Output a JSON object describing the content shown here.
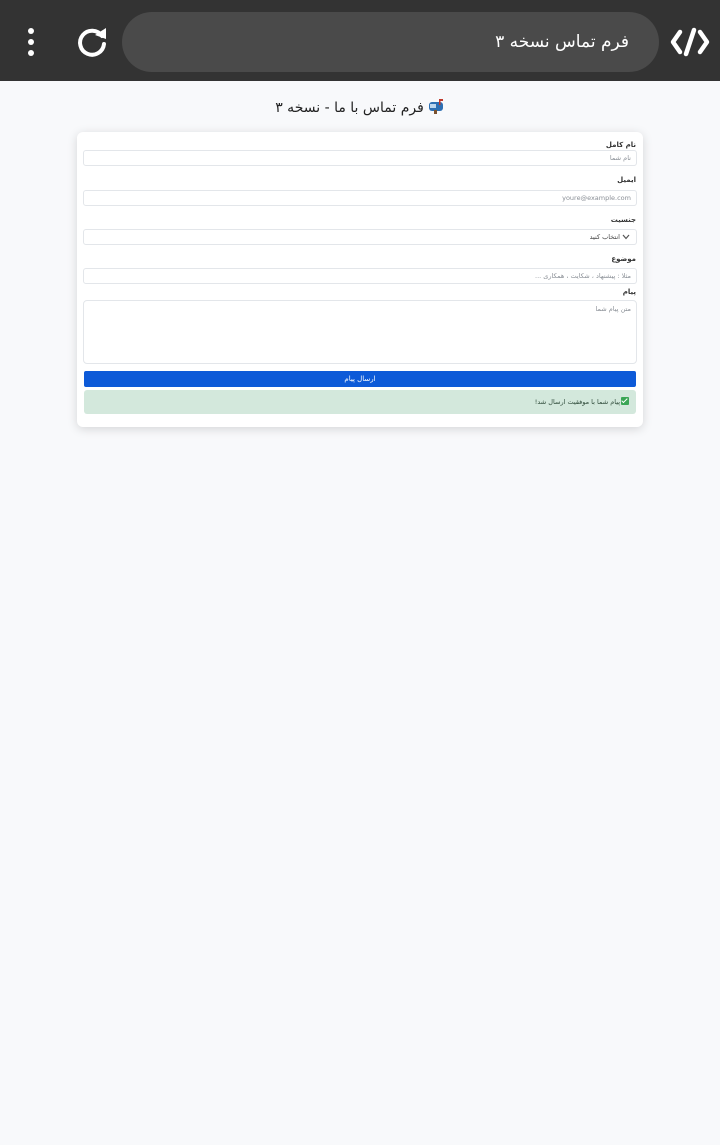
{
  "browser": {
    "address_text": "فرم تماس نسخه ۳",
    "menu_icon": "more-vert-icon",
    "reload_icon": "reload-icon",
    "logo_icon": "code-logo-icon"
  },
  "page": {
    "title": "فرم تماس با ما - نسخه ۳",
    "title_icon": "mailbox-icon"
  },
  "form": {
    "fullname_label": "نام کامل",
    "fullname_placeholder": "نام شما",
    "email_label": "ایمیل",
    "email_placeholder": "youre@example.com",
    "gender_label": "جنسیت",
    "gender_selected": "انتخاب کنید",
    "subject_label": "موضوع",
    "subject_placeholder": "مثلا : پیشنهاد ، شکایت ، همکاری ...",
    "message_label": "پیام",
    "message_placeholder": "متن پیام شما",
    "submit_label": "ارسال پیام"
  },
  "alert": {
    "text": "پیام شما با موفقیت ارسال شد!",
    "icon": "check-icon"
  },
  "colors": {
    "toolbar": "#333333",
    "accent": "#0d5ad8",
    "success_bg": "#d3e8dc"
  }
}
